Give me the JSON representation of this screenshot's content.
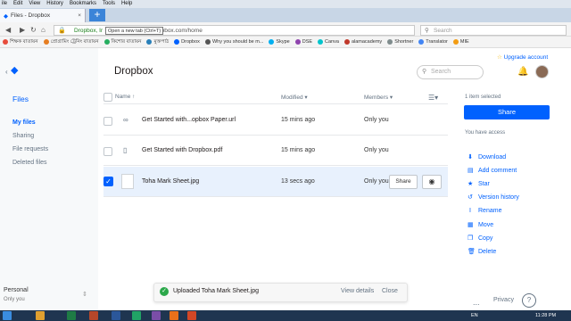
{
  "browser": {
    "menu": [
      "ile",
      "Edit",
      "View",
      "History",
      "Bookmarks",
      "Tools",
      "Help"
    ],
    "tab_title": "Files - Dropbox",
    "new_tab_tooltip": "Open a new tab (Ctrl+T)",
    "url_org": "Dropbox, Ir",
    "url_path": "opbox.com/home",
    "search_placeholder": "Search",
    "bookmarks": [
      {
        "label": "শিক্ষক বাতায়ন",
        "color": "#e74c3c"
      },
      {
        "label": "প্রোগ্রামিং ট্রেনিং বাতায়ন",
        "color": "#e67e22"
      },
      {
        "label": "কিশোর বাতায়ন",
        "color": "#27ae60"
      },
      {
        "label": "মুক্তপাঠ",
        "color": "#2980b9"
      },
      {
        "label": "Dropbox",
        "color": "#0061fe"
      },
      {
        "label": "Why you should be m...",
        "color": "#555555"
      },
      {
        "label": "Skype",
        "color": "#00aff0"
      },
      {
        "label": "DSE",
        "color": "#8e44ad"
      },
      {
        "label": "Canva",
        "color": "#00c4cc"
      },
      {
        "label": "alamacademy",
        "color": "#c0392b"
      },
      {
        "label": "Shortner",
        "color": "#7f8c8d"
      },
      {
        "label": "Translator",
        "color": "#4285f4"
      },
      {
        "label": "MIE",
        "color": "#f39c12"
      }
    ]
  },
  "sidebar": {
    "title": "Files",
    "items": [
      "My files",
      "Sharing",
      "File requests",
      "Deleted files"
    ],
    "account_name": "Personal",
    "account_sub": "Only you"
  },
  "main": {
    "title": "Dropbox",
    "search_placeholder": "Search",
    "upgrade_label": "Upgrade account",
    "columns": {
      "name": "Name",
      "modified": "Modified",
      "members": "Members"
    },
    "rows": [
      {
        "name": "Get Started with...opbox Paper.url",
        "modified": "15 mins ago",
        "members": "Only you",
        "icon": "link-icon"
      },
      {
        "name": "Get Started with Dropbox.pdf",
        "modified": "15 mins ago",
        "members": "Only you",
        "icon": "pdf-icon"
      },
      {
        "name": "Toha Mark Sheet.jpg",
        "modified": "13 secs ago",
        "members": "Only you",
        "icon": "image-icon"
      }
    ],
    "row_share_label": "Share"
  },
  "info_panel": {
    "selected_count": "1 item selected",
    "share_label": "Share",
    "access_text": "You have access",
    "actions": [
      {
        "label": "Download",
        "icon": "download-icon"
      },
      {
        "label": "Add comment",
        "icon": "comment-icon"
      },
      {
        "label": "Star",
        "icon": "star-icon"
      },
      {
        "label": "Version history",
        "icon": "history-icon"
      },
      {
        "label": "Rename",
        "icon": "rename-icon"
      },
      {
        "label": "Move",
        "icon": "move-icon"
      },
      {
        "label": "Copy",
        "icon": "copy-icon"
      },
      {
        "label": "Delete",
        "icon": "delete-icon"
      }
    ]
  },
  "toast": {
    "message": "Uploaded Toha Mark Sheet.jpg",
    "view_label": "View details",
    "close_label": "Close"
  },
  "footer": {
    "more_label": "...",
    "privacy_label": "Privacy",
    "help_label": "?"
  },
  "taskbar": {
    "lang": "EN",
    "time": "11:28 PM"
  }
}
